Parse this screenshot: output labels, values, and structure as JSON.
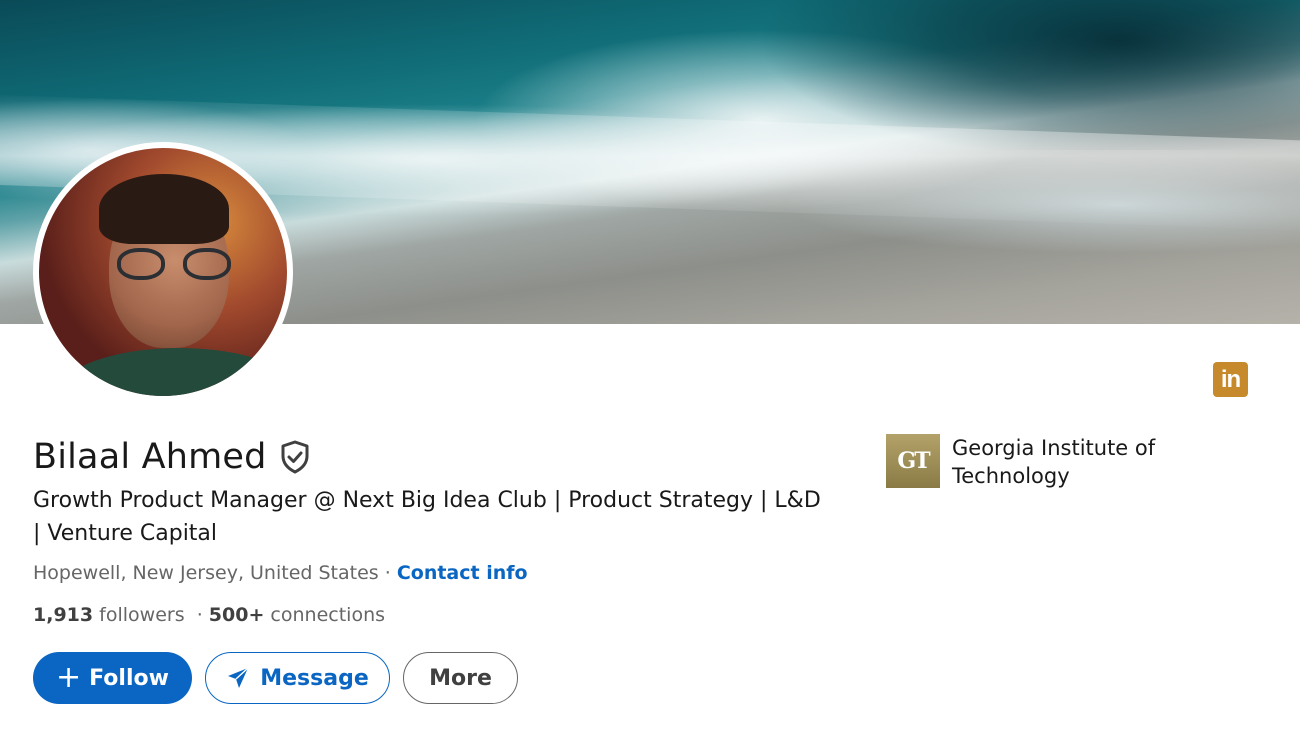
{
  "profile": {
    "name": "Bilaal Ahmed",
    "headline": "Growth Product Manager @ Next Big Idea Club | Product Strategy | L&D | Venture Capital",
    "location": "Hopewell, New Jersey, United States",
    "separator": "·",
    "contact_info": "Contact info",
    "followers_count": "1,913",
    "followers_label": "followers",
    "connections_count": "500+",
    "connections_label": "connections"
  },
  "actions": {
    "follow_label": "Follow",
    "follow_icon": "+",
    "message_label": "Message",
    "more_label": "More"
  },
  "education": {
    "school_name": "Georgia Institute of Technology",
    "school_logo_text": "GT"
  },
  "brand": {
    "linkedin_badge": "in",
    "accent": "#0a66c2",
    "badge_color": "#c68a2d"
  },
  "icons": {
    "verified": "shield-check-icon",
    "message": "send-icon",
    "linkedin": "linkedin-icon"
  }
}
